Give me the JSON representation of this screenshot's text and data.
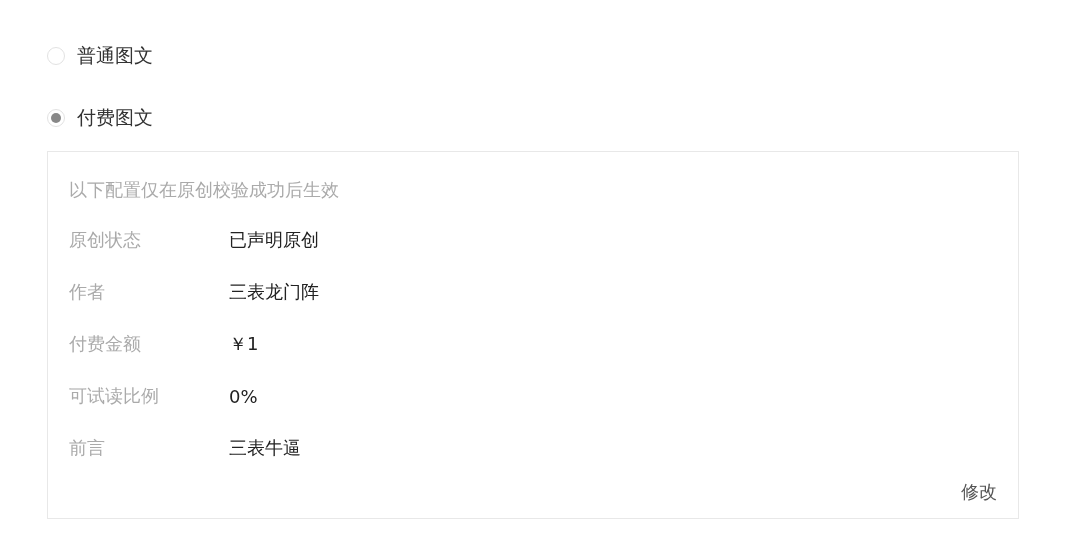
{
  "options": [
    {
      "label": "普通图文",
      "selected": false
    },
    {
      "label": "付费图文",
      "selected": true
    }
  ],
  "panel": {
    "note": "以下配置仅在原创校验成功后生效",
    "fields": [
      {
        "label": "原创状态",
        "value": "已声明原创"
      },
      {
        "label": "作者",
        "value": "三表龙门阵"
      },
      {
        "label": "付费金额",
        "value": "￥1"
      },
      {
        "label": "可试读比例",
        "value": "0%"
      },
      {
        "label": "前言",
        "value": "三表牛逼"
      }
    ],
    "edit_link": "修改"
  }
}
